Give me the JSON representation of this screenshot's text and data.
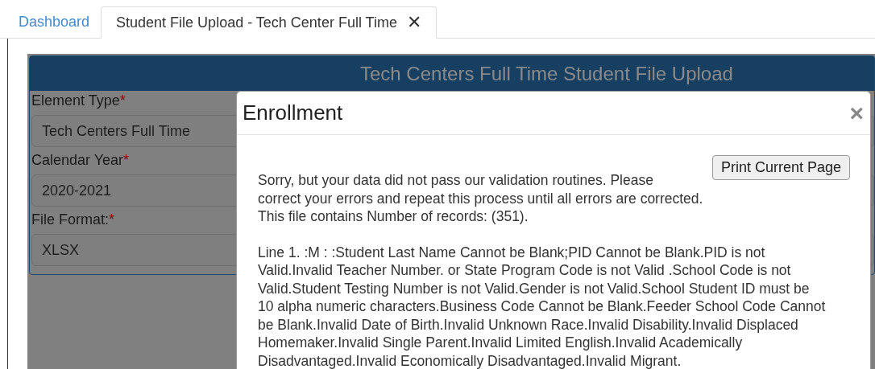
{
  "tabs": [
    {
      "label": "Dashboard",
      "selected": false,
      "closable": false
    },
    {
      "label": "Student File Upload - Tech Center Full Time",
      "selected": true,
      "closable": true
    }
  ],
  "tab_close": "✕",
  "panel": {
    "title": "Tech Centers Full Time Student File Upload",
    "fields": [
      {
        "label": "Element Type",
        "required": true,
        "value": "Tech Centers Full Time"
      },
      {
        "label": "Calendar Year",
        "required": true,
        "value": "2020-2021"
      },
      {
        "label": "File Format:",
        "required": true,
        "value": "XLSX"
      }
    ]
  },
  "required_mark": "*",
  "modal": {
    "title": "Enrollment",
    "close": "×",
    "print_button": "Print Current Page",
    "message_lines": [
      "Sorry, but your data did not pass our validation routines. Please",
      "correct your errors and repeat this process until all errors are corrected.",
      "This file contains Number of records: (351)."
    ],
    "errors": "Line 1. :M : :Student Last Name Cannot be Blank;PID Cannot be Blank.PID is not Valid.Invalid Teacher Number. or State Program Code is not Valid .School Code is not Valid.Student Testing Number is not Valid.Gender is not Valid.School Student ID must be 10 alpha numeric characters.Business Code Cannot be Blank.Feeder School Code Cannot be Blank.Invalid Date of Birth.Invalid Unknown Race.Invalid Disability.Invalid Displaced Homemaker.Invalid Single Parent.Invalid Limited English.Invalid Academically Disadvantaged.Invalid Economically Disadvantaged.Invalid Migrant."
  }
}
